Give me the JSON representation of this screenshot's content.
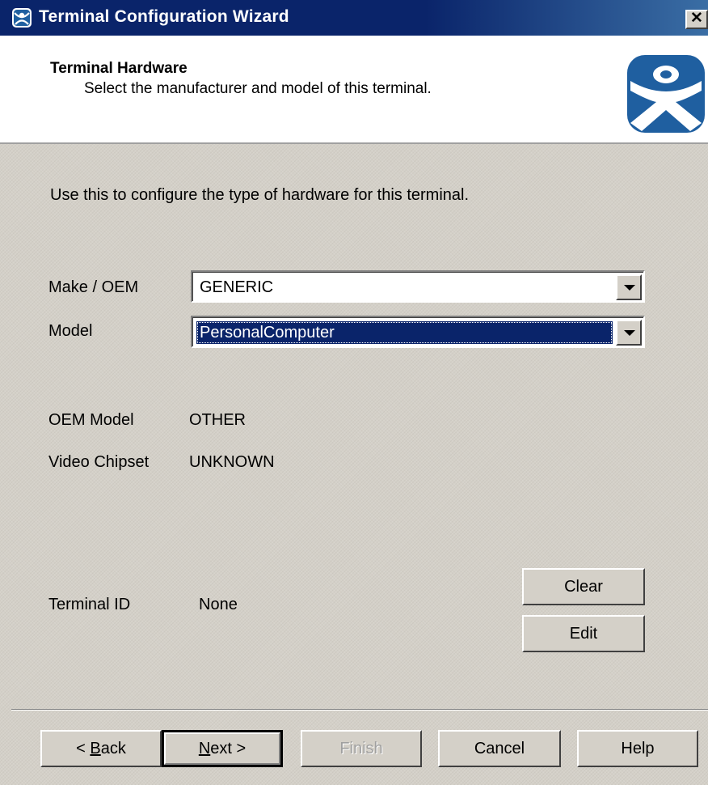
{
  "window": {
    "title": "Terminal Configuration Wizard",
    "close_label": "✕"
  },
  "header": {
    "title": "Terminal Hardware",
    "subtitle": "Select the manufacturer and model of this terminal."
  },
  "body": {
    "description": "Use this to configure the type of hardware for this terminal.",
    "make_label": "Make / OEM",
    "make_value": "GENERIC",
    "model_label": "Model",
    "model_value": "PersonalComputer",
    "oem_model_label": "OEM Model",
    "oem_model_value": "OTHER",
    "video_chipset_label": "Video Chipset",
    "video_chipset_value": "UNKNOWN",
    "terminal_id_label": "Terminal ID",
    "terminal_id_value": "None",
    "clear_label": "Clear",
    "edit_label": "Edit"
  },
  "footer": {
    "back_prefix": "< ",
    "back_mnemonic": "B",
    "back_rest": "ack",
    "next_mnemonic": "N",
    "next_rest": "ext >",
    "finish_label": "Finish",
    "cancel_label": "Cancel",
    "help_label": "Help"
  },
  "colors": {
    "titlebar": "#0a246a",
    "face": "#d4d0c8",
    "selection": "#0a246a",
    "logo": "#1f5fa0"
  },
  "icons": {
    "title": "person-logo-icon",
    "header": "person-logo-icon",
    "dropdown": "chevron-down-icon"
  }
}
